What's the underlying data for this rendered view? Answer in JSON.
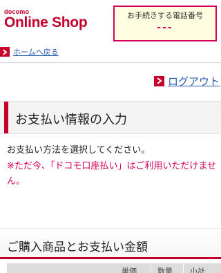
{
  "header": {
    "logo_small": "docomo",
    "logo_main": "Online Shop",
    "phone_label": "お手続きする電話番号",
    "phone_value": "---"
  },
  "nav": {
    "back_home": "ホームへ戻る",
    "logout": "ログアウト"
  },
  "payment_section": {
    "title": "お支払い情報の入力",
    "instruction": "お支払い方法を選択してください。",
    "warning": "※ただ今、「ドコモ口座払い」はご利用いただけません。"
  },
  "purchase_section": {
    "title": "ご購入商品とお支払い金額",
    "columns": [
      "単価",
      "数量",
      "小計"
    ]
  },
  "colors": {
    "brand_red": "#c4002b",
    "accent_pink": "#d4005a",
    "link_blue": "#2a5db0"
  }
}
